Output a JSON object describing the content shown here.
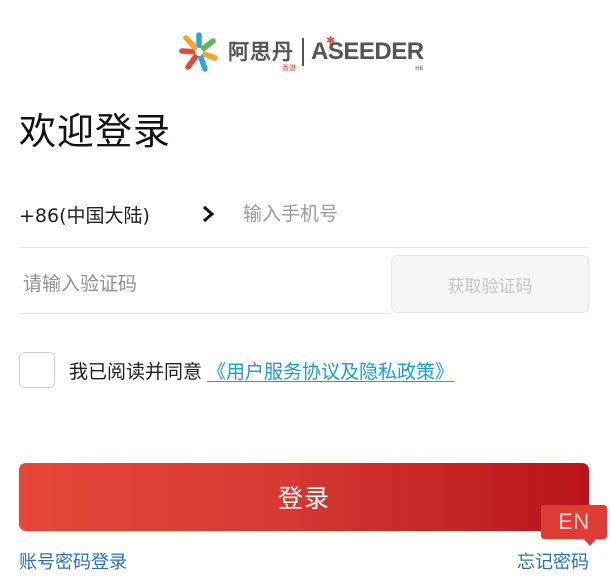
{
  "logo": {
    "name_cn": "阿思丹",
    "region_cn": "香港",
    "name_en_lead": "A",
    "name_en_rest": "SEEDER",
    "region_en": "HK",
    "mark_icon": "aseeder-starburst-icon",
    "colors": {
      "red": "#e24a3b",
      "orange": "#f4a32c",
      "green": "#5bb84f",
      "blue": "#2aa6de",
      "gray": "#555555"
    }
  },
  "title": "欢迎登录",
  "phone": {
    "country_code": "+86(中国大陆)",
    "chevron_icon": "chevron-right-icon",
    "placeholder": "输入手机号",
    "value": ""
  },
  "code": {
    "placeholder": "请输入验证码",
    "value": "",
    "get_code_label": "获取验证码"
  },
  "agreement": {
    "checked": false,
    "text": "我已阅读并同意",
    "link_label": "《用户服务协议及隐私政策》"
  },
  "login_button": "登录",
  "language_badge": "EN",
  "links": {
    "password_login": "账号密码登录",
    "forgot_password": "忘记密码"
  },
  "colors": {
    "accent_red": "#e6473a",
    "accent_red_dark": "#b8141a",
    "link_blue": "#2b6fb6",
    "agreement_link_blue": "#1b9bd8"
  }
}
